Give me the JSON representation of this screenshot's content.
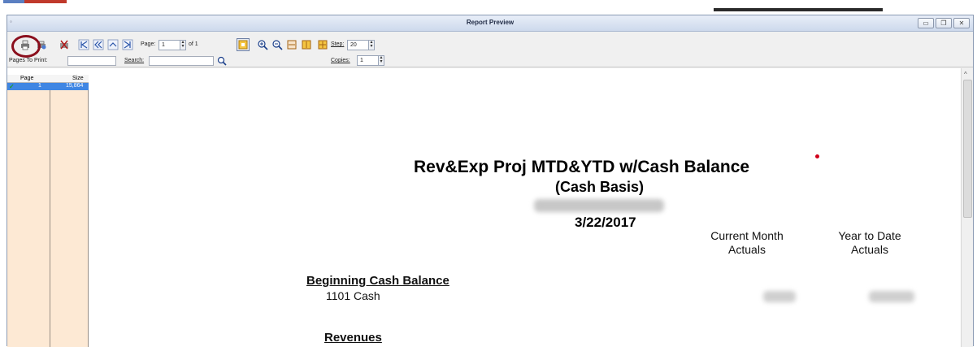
{
  "window": {
    "title": "Report Preview",
    "buttons": {
      "minimize": "▭",
      "restore": "❐",
      "close": "✕"
    }
  },
  "toolbar": {
    "page_label": "Page:",
    "page_value": "1",
    "page_of": "of 1",
    "step_label": "Step:",
    "step_value": "20",
    "copies_label": "Copies:",
    "copies_value": "1"
  },
  "filters": {
    "pages_to_print_label": "Pages To Print:",
    "search_label": "Search:"
  },
  "page_list": {
    "headers": [
      "Page",
      "Size"
    ],
    "rows": [
      {
        "page": "1",
        "size": "15,864"
      }
    ]
  },
  "report": {
    "title": "Rev&Exp Proj MTD&YTD w/Cash Balance",
    "subtitle": "(Cash Basis)",
    "date": "3/22/2017",
    "col1_line1": "Current Month",
    "col1_line2": "Actuals",
    "col2_line1": "Year to Date",
    "col2_line2": "Actuals",
    "section1": "Beginning Cash Balance",
    "account1": "1101 Cash",
    "section2": "Revenues"
  },
  "colors": {
    "selection": "#3f86e3",
    "page_list_bg": "#fde9d4",
    "annotation": "#8b0f1d"
  },
  "icons": [
    "print-icon",
    "printer-setup-icon",
    "export-icon",
    "first-page-icon",
    "previous-page-icon",
    "next-page-icon",
    "last-page-icon",
    "fit-page-icon",
    "zoom-in-icon",
    "zoom-out-icon",
    "fit-width-icon",
    "fit-height-icon",
    "full-page-icon",
    "search-icon",
    "check-icon"
  ]
}
